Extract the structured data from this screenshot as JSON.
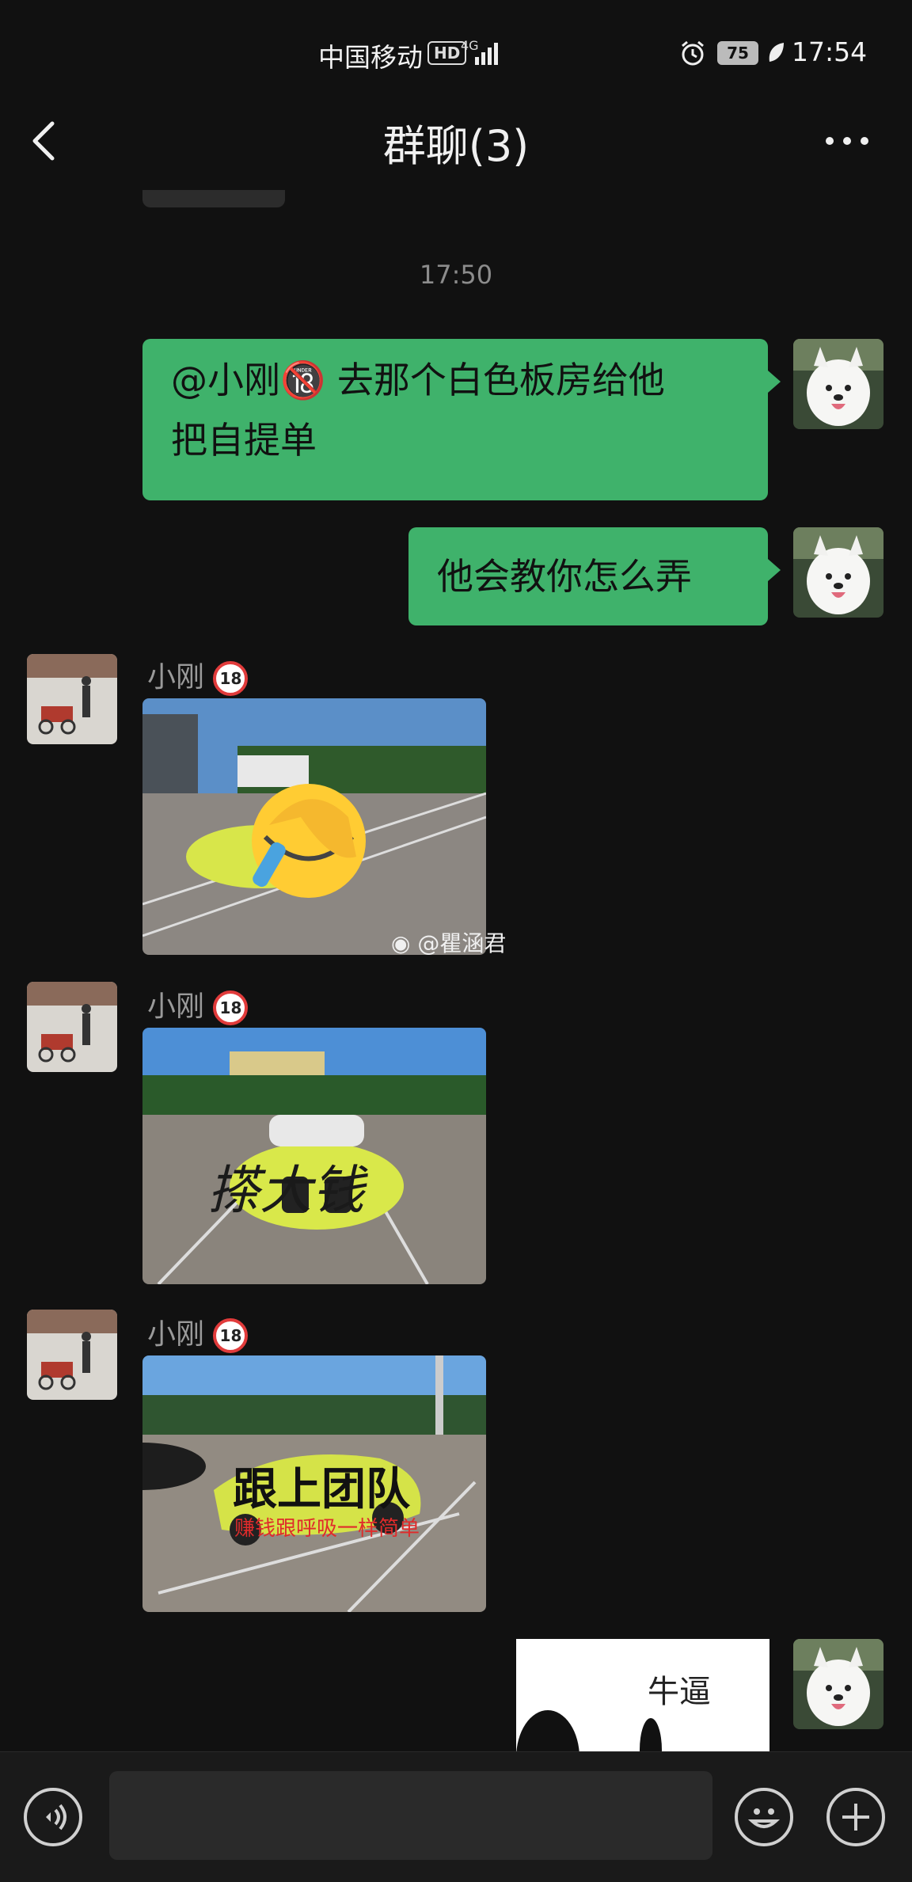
{
  "status_bar": {
    "carrier": "中国移动",
    "hd_badge": "HD",
    "network": "4G",
    "battery": "75",
    "time": "17:54"
  },
  "header": {
    "title": "群聊(3)"
  },
  "chat": {
    "time_separator": "17:50",
    "messages": [
      {
        "sender": "me",
        "text_line1": "@小刚🔞 去那个白色板房给他",
        "text_line2": "把自提单"
      },
      {
        "sender": "me",
        "text": "他会教你怎么弄"
      },
      {
        "sender": "小刚",
        "name": "小刚",
        "watermark": "@瞿涵君"
      },
      {
        "sender": "小刚",
        "name": "小刚",
        "overlay_text": "搽大钱"
      },
      {
        "sender": "小刚",
        "name": "小刚",
        "overlay_title": "跟上团队",
        "overlay_subtitle": "赚钱跟呼吸一样简单"
      },
      {
        "sender": "me",
        "sticker_text": "牛逼"
      }
    ]
  },
  "icons": {
    "back": "chevron-left-icon",
    "more": "more-dots-icon",
    "voice": "voice-icon",
    "emoji": "emoji-icon",
    "add": "plus-icon"
  },
  "colors": {
    "background": "#111111",
    "my_bubble": "#3fb26b",
    "bottom_bar": "#1a1a1a"
  }
}
